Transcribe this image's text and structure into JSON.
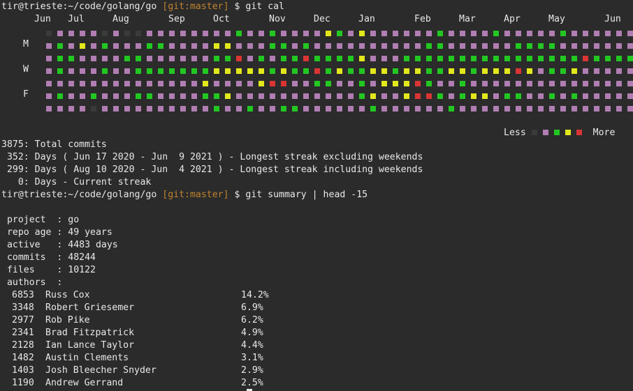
{
  "prompt1": {
    "userhost": "tir@trieste:~/code/golang/go",
    "branch": "[git:master]",
    "symbol": "$",
    "command": "git cal"
  },
  "calendar": {
    "months": [
      "Jun",
      "Jul",
      "Aug",
      "Sep",
      "Oct",
      "Nov",
      "Dec",
      "Jan",
      "Feb",
      "Mar",
      "Apr",
      "May",
      "Jun"
    ],
    "day_labels": {
      "m": "M",
      "w": "W",
      "f": "F"
    },
    "colors": {
      "0": "#3a3a3a",
      "1": "#b07eb2",
      "2": "#22c722",
      "3": "#e2e81c",
      "4": "#d93535"
    },
    "grid": [
      "0111101001111111121121111321311111121111211111211111100",
      "1213121112211113311122121111111111221111112222111111110",
      "1221111221111112241212242222311122222222222222224222211",
      "1211121122222223333323224232233233223323334312231111101",
      "1111111111111131111344112211213334211211111111111111110",
      "1211211122111122311111111111231134421233122112121111111",
      "1111011111111112112112211111121111112111111111111111100"
    ],
    "legend": {
      "less": "Less",
      "more": "More",
      "levels": [
        0,
        1,
        2,
        3,
        4
      ]
    }
  },
  "stats": [
    "3875: Total commits",
    " 352: Days ( Jun 17 2020 - Jun  9 2021 ) - Longest streak excluding weekends",
    " 299: Days ( Aug 10 2020 - Jun  4 2021 ) - Longest streak including weekends",
    "   0: Days - Current streak"
  ],
  "prompt2": {
    "userhost": "tir@trieste:~/code/golang/go",
    "branch": "[git:master]",
    "symbol": "$",
    "command": "git summary | head -15"
  },
  "summary": {
    "project": " project  : go",
    "repo_age": " repo age : 49 years",
    "active": " active   : 4483 days",
    "commits": " commits  : 48244",
    "files": " files    : 10122",
    "authors_header": " authors  :"
  },
  "authors": [
    {
      "count": "6853",
      "name": "Russ Cox",
      "pct": "14.2%"
    },
    {
      "count": "3348",
      "name": "Robert Griesemer",
      "pct": "6.9%"
    },
    {
      "count": "2977",
      "name": "Rob Pike",
      "pct": "6.2%"
    },
    {
      "count": "2341",
      "name": "Brad Fitzpatrick",
      "pct": "4.9%"
    },
    {
      "count": "2128",
      "name": "Ian Lance Taylor",
      "pct": "4.4%"
    },
    {
      "count": "1482",
      "name": "Austin Clements",
      "pct": "3.1%"
    },
    {
      "count": "1403",
      "name": "Josh Bleecher Snyder",
      "pct": "2.9%"
    },
    {
      "count": "1190",
      "name": "Andrew Gerrand",
      "pct": "2.5%"
    }
  ]
}
